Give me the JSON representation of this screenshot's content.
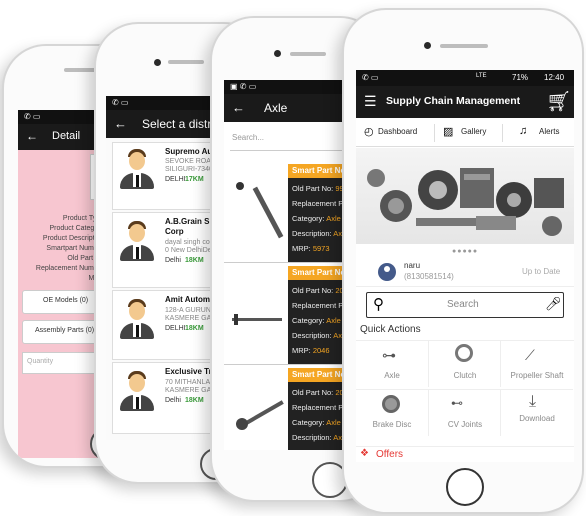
{
  "screen_detail": {
    "title": "Detail",
    "fields": [
      "Product Type",
      "Product Category",
      "Product Description",
      "Smartpart Number",
      "Old Part No",
      "Replacement Number",
      "MRP"
    ],
    "buttons": [
      "OE Models (0)",
      "Assembly Parts (0)"
    ],
    "quantity_placeholder": "Quantity",
    "colors": {
      "background": "#f7c6d0"
    }
  },
  "screen_distributor": {
    "title": "Select a distri",
    "distributors": [
      {
        "name": "Supremo Auto",
        "address1": "SEVOKE ROAD, ...",
        "address2": "SILIGURI-73400...",
        "city": "DELHI",
        "distance": "17KM"
      },
      {
        "name": "A.B.Grain Spir",
        "name2": "Corp",
        "address1": "dayal singh coll...",
        "address2": "0 New DelhiDel...",
        "city": "Delhi",
        "distance": "18KM"
      },
      {
        "name": "Amit Automoti",
        "address1": "128-A GURUNA...",
        "address2": "KASMERE GATE...",
        "city": "DELHI",
        "distance": "18KM"
      },
      {
        "name": "Exclusive Trad",
        "address1": "70 MITHANLAL...",
        "address2": "KASMERE GATE",
        "city": "Delhi",
        "distance": "18KM"
      }
    ]
  },
  "screen_axle": {
    "title": "Axle",
    "search_placeholder": "Search...",
    "parts": [
      {
        "header": "Smart Part No",
        "old_label": "Old Part No:",
        "old_val": "99",
        "repl_label": "Replacement Pa",
        "cat_label": "Category:",
        "cat_val": "Axle S",
        "desc_label": "Description:",
        "desc_val": "Axl",
        "mrp_label": "MRP:",
        "mrp_val": "5973"
      },
      {
        "header": "Smart Part No",
        "old_label": "Old Part No:",
        "old_val": "20",
        "repl_label": "Replacement Pa",
        "cat_label": "Category:",
        "cat_val": "Axle S",
        "desc_label": "Description:",
        "desc_val": "Axl",
        "mrp_label": "MRP:",
        "mrp_val": "2046"
      },
      {
        "header": "Smart Part No",
        "old_label": "Old Part No:",
        "old_val": "20",
        "repl_label": "Replacement Pa",
        "cat_label": "Category:",
        "cat_val": "Axle S",
        "desc_label": "Description:",
        "desc_val": "Axl",
        "mrp_label": "",
        "mrp_val": ""
      }
    ]
  },
  "screen_main": {
    "status_time": "12:40",
    "status_battery": "71%",
    "status_network": "LTE",
    "title": "Supply Chain Management",
    "tabs": [
      {
        "label": "Dashboard",
        "icon": "speedometer-icon"
      },
      {
        "label": "Gallery",
        "icon": "gallery-icon"
      },
      {
        "label": "Alerts",
        "icon": "bell-icon"
      }
    ],
    "user": {
      "name": "naru",
      "phone": "(8130581514)",
      "status": "Up to Date"
    },
    "search_placeholder": "Search",
    "quick_actions_title": "Quick Actions",
    "quick_actions": [
      "Axle",
      "Clutch",
      "Propeller Shaft",
      "Brake Disc",
      "CV Joints",
      "Download"
    ],
    "offers_label": "Offers",
    "colors": {
      "accent": "#e53935",
      "appbar": "#1a1a1a"
    }
  }
}
